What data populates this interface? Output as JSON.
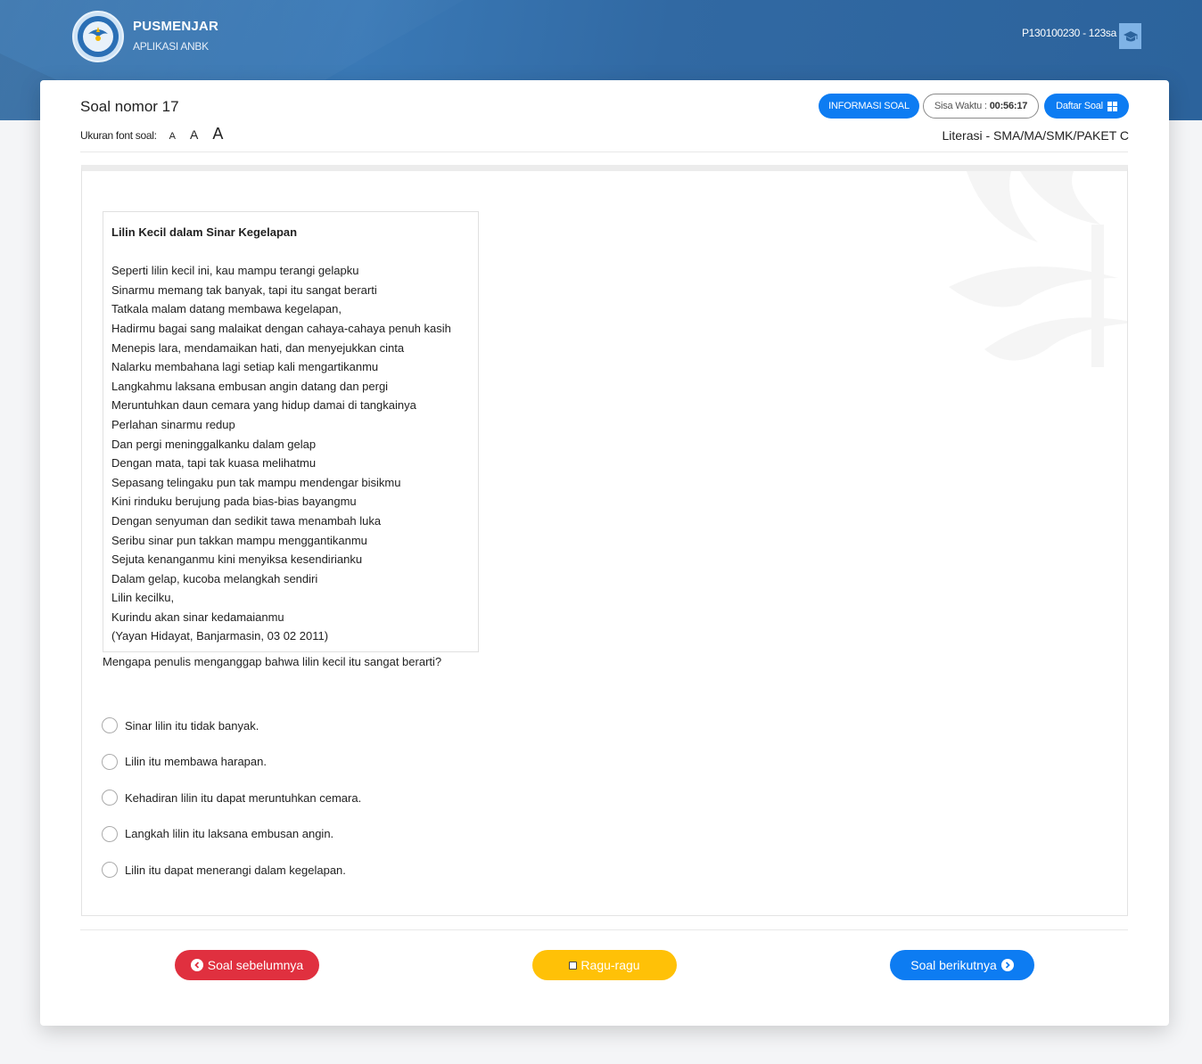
{
  "header": {
    "brand_title": "PUSMENJAR",
    "brand_subtitle": "APLIKASI ANBK",
    "user_id": "P130100230 - 123sa",
    "user_icon": "graduation-cap-icon",
    "logo": "tut-wuri-handayani-logo"
  },
  "question": {
    "title": "Soal nomor 17",
    "font_size_label": "Ukuran font soal:",
    "font_size_options": [
      "A",
      "A",
      "A"
    ],
    "subject": "Literasi - SMA/MA/SMK/PAKET C",
    "prompt": "Mengapa penulis menganggap bahwa lilin kecil itu sangat berarti?"
  },
  "toolbar": {
    "info_label": "INFORMASI SOAL",
    "timer_label": "Sisa Waktu :",
    "timer_value": "00:56:17",
    "list_label": "Daftar Soal",
    "list_icon": "grid-icon"
  },
  "poem": {
    "title": "Lilin Kecil dalam Sinar Kegelapan",
    "lines": [
      "Seperti lilin kecil ini, kau mampu terangi gelapku",
      "Sinarmu memang tak banyak, tapi itu sangat berarti",
      "Tatkala malam datang membawa kegelapan,",
      "Hadirmu bagai sang malaikat dengan cahaya-cahaya penuh kasih",
      "Menepis lara, mendamaikan hati, dan menyejukkan cinta",
      "Nalarku membahana lagi setiap kali mengartikanmu",
      "Langkahmu laksana embusan angin datang dan pergi",
      "Meruntuhkan daun cemara yang hidup damai di tangkainya",
      "Perlahan sinarmu redup",
      "Dan pergi meninggalkanku dalam gelap",
      "Dengan mata, tapi tak kuasa melihatmu",
      "Sepasang telingaku pun tak mampu mendengar bisikmu",
      "Kini rinduku berujung pada bias-bias bayangmu",
      "Dengan senyuman dan sedikit tawa menambah luka",
      "Seribu sinar pun takkan mampu menggantikanmu",
      "Sejuta kenanganmu kini menyiksa kesendirianku",
      "Dalam gelap, kucoba melangkah sendiri",
      "Lilin kecilku,",
      "Kurindu akan sinar kedamaianmu",
      "(Yayan Hidayat, Banjarmasin, 03 02 2011)"
    ]
  },
  "options": [
    "Sinar lilin itu tidak banyak.",
    "Lilin itu membawa harapan.",
    "Kehadiran lilin itu dapat meruntuhkan cemara.",
    "Langkah lilin itu laksana embusan angin.",
    "Lilin itu dapat menerangi dalam kegelapan."
  ],
  "navigation": {
    "prev_label": "Soal sebelumnya",
    "prev_icon": "chevron-left-circle-icon",
    "doubt_label": "Ragu-ragu",
    "doubt_icon": "checkbox-icon",
    "next_label": "Soal berikutnya",
    "next_icon": "chevron-right-circle-icon"
  },
  "colors": {
    "header_blue": "#3169a3",
    "primary": "#0d7cf2",
    "danger": "#e0303f",
    "warning": "#ffc107"
  }
}
